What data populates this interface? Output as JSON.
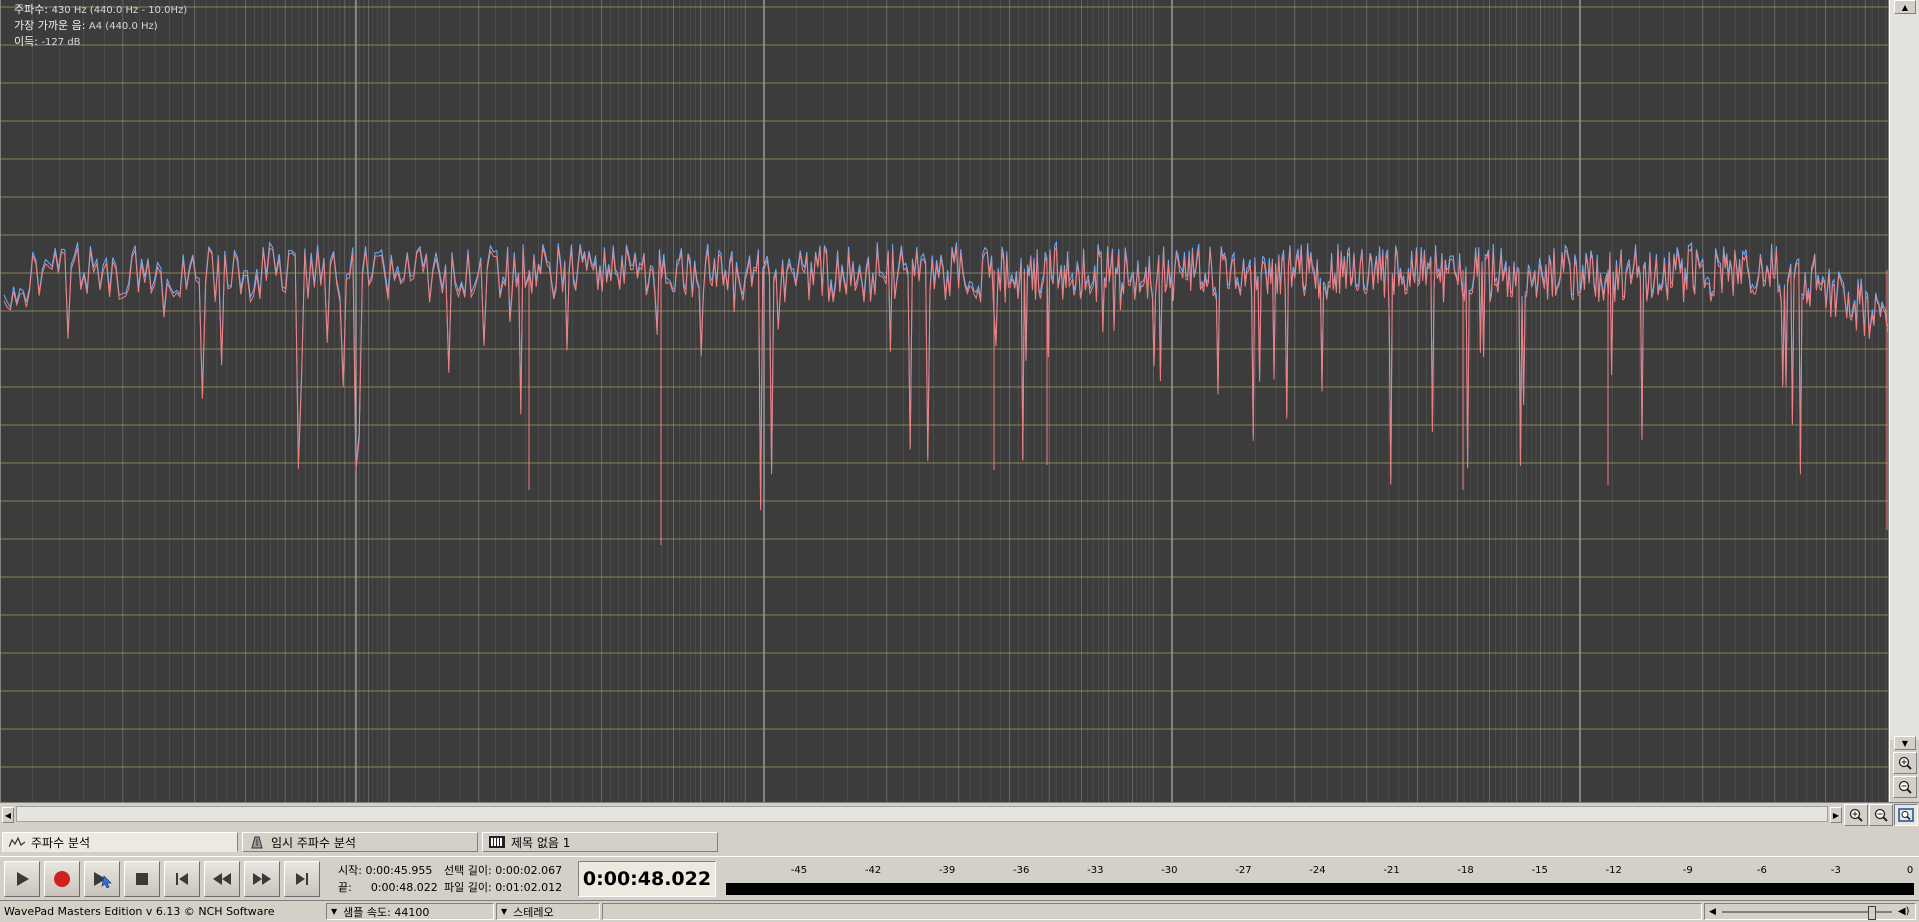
{
  "readout": {
    "freq_label": "주파수:",
    "freq_value": "430 Hz (440.0 Hz - 10.0Hz)",
    "note_label": "가장 가까운 음:",
    "note_value": "A4 (440.0 Hz)",
    "gain_label": "이득:",
    "gain_value": "-127 dB"
  },
  "colors": {
    "plot_bg": "#3c3c3c",
    "grid_major": "#c8c8c8",
    "grid_minor": "#707070",
    "grid_horizontal": "#a89a6a",
    "trace_blue": "#6ab0ff",
    "trace_red": "#f08080"
  },
  "tabs": [
    {
      "label": "주파수 분석",
      "icon": "frequency-analysis-icon",
      "active": true
    },
    {
      "label": "임시 주파수 분석",
      "icon": "temporary-frequency-analysis-icon",
      "active": false
    },
    {
      "label": "제목 없음 1",
      "icon": "audio-file-icon",
      "active": false
    }
  ],
  "transport": {
    "buttons": [
      "play-icon",
      "record-icon",
      "play-from-cursor-icon",
      "stop-icon",
      "skip-to-start-icon",
      "rewind-icon",
      "fast-forward-icon",
      "skip-to-end-icon"
    ]
  },
  "time": {
    "start_label": "시작:",
    "start_value": "0:00:45.955",
    "end_label": "끝:",
    "end_value": "0:00:48.022",
    "sel_len_label": "선택 길이:",
    "sel_len_value": "0:00:02.067",
    "file_len_label": "파일 길이:",
    "file_len_value": "0:01:02.012",
    "current": "0:00:48.022"
  },
  "meter": {
    "ticks": [
      "-45",
      "-42",
      "-39",
      "-36",
      "-33",
      "-30",
      "-27",
      "-24",
      "-21",
      "-18",
      "-15",
      "-12",
      "-9",
      "-6",
      "-3",
      "0"
    ]
  },
  "status": {
    "app": "WavePad Masters Edition v 6.13 © NCH Software",
    "sample_rate_label": "샘플 속도: 44100",
    "channels_label": "스테레오"
  },
  "volume_level": 0.88
}
